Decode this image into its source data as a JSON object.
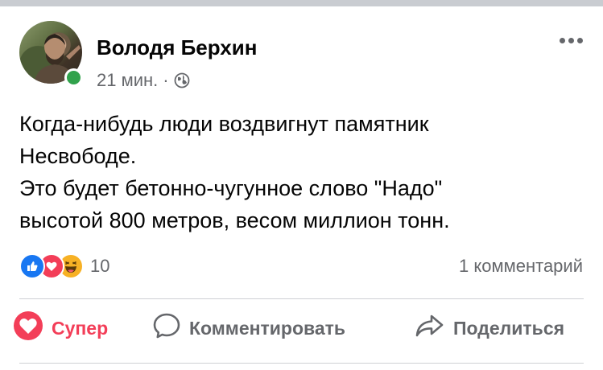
{
  "post": {
    "author": "Володя Берхин",
    "time": "21 мин.",
    "separator": "·",
    "privacy_icon": "globe-icon",
    "more_icon": "ellipsis-icon",
    "online": true,
    "text_lines": [
      "Когда-нибудь люди воздвигнут памятник",
      "Несвободе.",
      "Это будет бетонно-чугунное слово \"Надо\"",
      "высотой 800 метров, весом миллион тонн."
    ]
  },
  "stats": {
    "reactions": [
      "like-icon",
      "love-icon",
      "haha-icon"
    ],
    "reaction_count": "10",
    "comments": "1 комментарий"
  },
  "actions": {
    "super_label": "Супер",
    "super_icon": "care-icon",
    "comment_label": "Комментировать",
    "comment_icon": "comment-bubble-icon",
    "share_label": "Поделиться",
    "share_icon": "share-arrow-icon"
  },
  "colors": {
    "online": "#31a24c",
    "like": "#1877f2",
    "love": "#f33e58",
    "haha": "#f7b125",
    "secondary_text": "#65676b"
  }
}
